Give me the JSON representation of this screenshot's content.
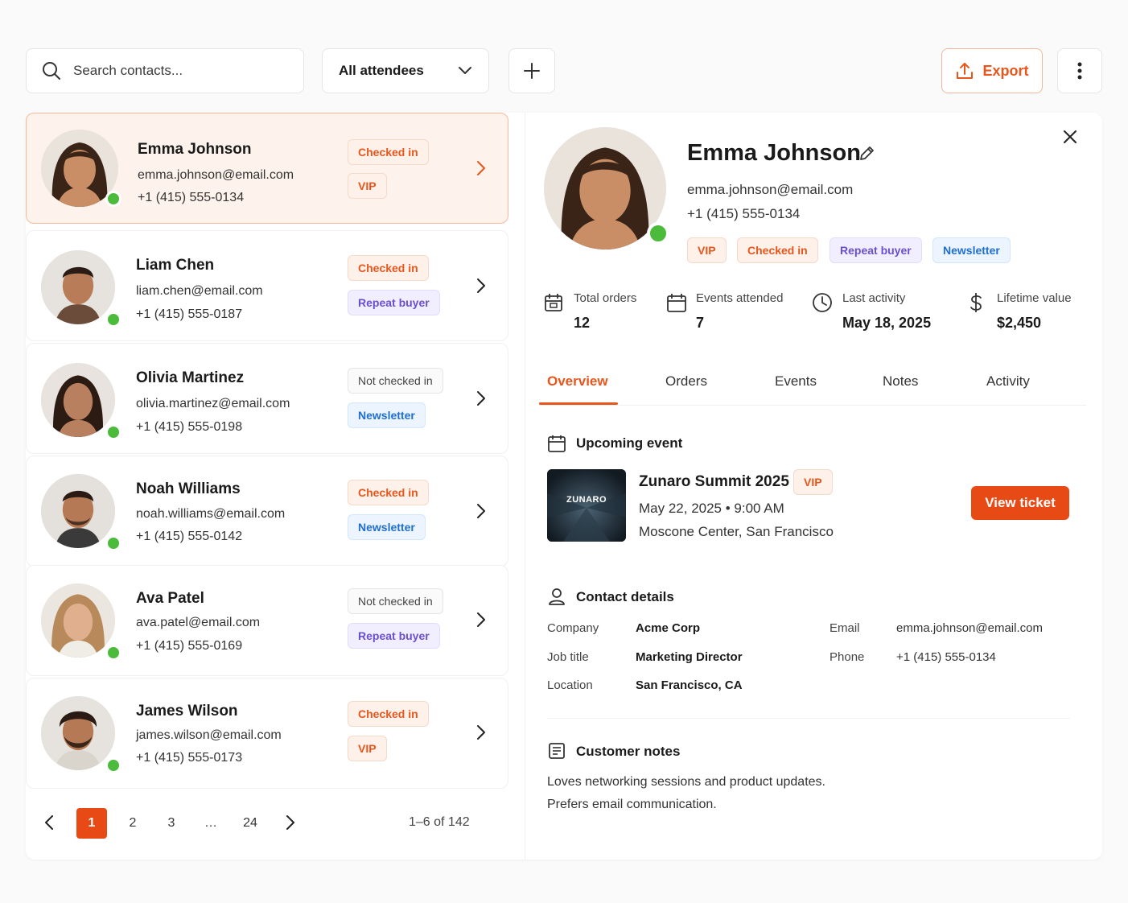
{
  "search": {
    "placeholder": "Search contacts..."
  },
  "filter": {
    "selected": "All attendees"
  },
  "toolbar": {
    "export_label": "Export"
  },
  "contacts": [
    {
      "name": "Emma Johnson",
      "email": "emma.johnson@email.com",
      "phone": "+1 (415) 555-0134",
      "badges": [
        "Checked in",
        "VIP"
      ]
    },
    {
      "name": "Liam Chen",
      "email": "liam.chen@email.com",
      "phone": "+1 (415) 555-0187",
      "badges": [
        "Checked in",
        "Repeat buyer"
      ]
    },
    {
      "name": "Olivia Martinez",
      "email": "olivia.martinez@email.com",
      "phone": "+1 (415) 555-0198",
      "badges": [
        "Not checked in",
        "Newsletter"
      ]
    },
    {
      "name": "Noah Williams",
      "email": "noah.williams@email.com",
      "phone": "+1 (415) 555-0142",
      "badges": [
        "Checked in",
        "Newsletter"
      ]
    },
    {
      "name": "Ava Patel",
      "email": "ava.patel@email.com",
      "phone": "+1 (415) 555-0169",
      "badges": [
        "Not checked in",
        "Repeat buyer"
      ]
    },
    {
      "name": "James Wilson",
      "email": "james.wilson@email.com",
      "phone": "+1 (415) 555-0173",
      "badges": [
        "Checked in",
        "VIP"
      ]
    }
  ],
  "pagination": {
    "pages": [
      "1",
      "2",
      "3",
      "…",
      "24"
    ],
    "range": "1–6 of 142"
  },
  "detail": {
    "name": "Emma Johnson",
    "email": "emma.johnson@email.com",
    "phone": "+1 (415) 555-0134",
    "badges": [
      "VIP",
      "Checked in",
      "Repeat buyer",
      "Newsletter"
    ],
    "stats": [
      {
        "label": "Total orders",
        "value": "12"
      },
      {
        "label": "Events attended",
        "value": "7"
      },
      {
        "label": "Last activity",
        "value": "May 18, 2025"
      },
      {
        "label": "Lifetime value",
        "value": "$2,450"
      }
    ],
    "tabs": [
      "Overview",
      "Orders",
      "Events",
      "Notes",
      "Activity"
    ],
    "upcoming": {
      "title": "Upcoming event",
      "thumb_text": "ZUNARO",
      "event_name": "Zunaro Summit 2025",
      "badge": "VIP",
      "datetime": "May 22, 2025 • 9:00 AM",
      "location": "Moscone Center, San Francisco",
      "button": "View ticket"
    },
    "contact_details": {
      "title": "Contact details",
      "company_label": "Company",
      "company": "Acme Corp",
      "job_label": "Job title",
      "job": "Marketing Director",
      "location_label": "Location",
      "location": "San Francisco, CA",
      "email_label": "Email",
      "email": "emma.johnson@email.com",
      "phone_label": "Phone",
      "phone": "+1 (415) 555-0134"
    },
    "notes": {
      "title": "Customer notes",
      "line1": "Loves networking sessions and product updates.",
      "line2": "Prefers email communication."
    }
  },
  "colors": {
    "accent": "#e8561c",
    "online": "#4cba3a",
    "selected_bg": "#fdf3ec"
  }
}
